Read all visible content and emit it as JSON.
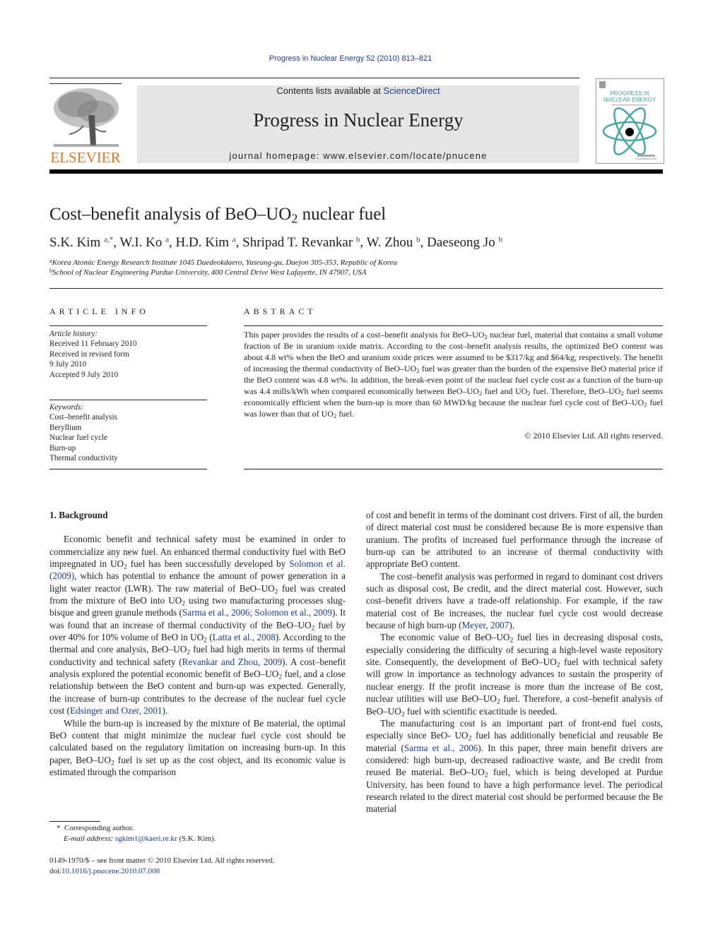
{
  "header": {
    "citation": "Progress in Nuclear Energy 52 (2010) 813–821",
    "contents_prefix": "Contents lists available at ",
    "contents_link": "ScienceDirect",
    "journal_title": "Progress in Nuclear Energy",
    "homepage": "journal homepage: www.elsevier.com/locate/pnucene",
    "publisher_logo_text": "ELSEVIER",
    "cover": {
      "title_line1": "PROGRESS IN",
      "title_line2": "NUCLEAR ENERGY",
      "accent_color": "#4aa6a0",
      "logo_color": "#e87722"
    }
  },
  "article": {
    "title_pre": "Cost–benefit analysis of BeO–UO",
    "title_sub": "2",
    "title_post": " nuclear fuel",
    "authors": [
      {
        "name": "S.K. Kim",
        "sup": "a,*"
      },
      {
        "name": "W.I. Ko",
        "sup": "a"
      },
      {
        "name": "H.D. Kim",
        "sup": "a"
      },
      {
        "name": "Shripad T. Revankar",
        "sup": "b"
      },
      {
        "name": "W. Zhou",
        "sup": "b"
      },
      {
        "name": "Daeseong Jo",
        "sup": "b"
      }
    ],
    "affiliations": [
      {
        "mark": "a",
        "text": "Korea Atomic Energy Research Institute 1045 Daedeokdaero, Yuseung-gu, Daejon 305-353, Republic of Korea"
      },
      {
        "mark": "b",
        "text": "School of Nuclear Engineering Purdue University, 400 Central Drive West Lafayette, IN 47907, USA"
      }
    ]
  },
  "article_info": {
    "heading": "ARTICLE INFO",
    "history_label": "Article history:",
    "history": [
      "Received 11 February 2010",
      "Received in revised form",
      "9 July 2010",
      "Accepted 9 July 2010"
    ],
    "keywords_label": "Keywords:",
    "keywords": [
      "Cost–benefit analysis",
      "Beryllium",
      "Nuclear fuel cycle",
      "Burn-up",
      "Thermal conductivity"
    ]
  },
  "abstract": {
    "heading": "ABSTRACT",
    "segments": [
      "This paper provides the results of a cost–benefit analysis for BeO–UO",
      "2",
      " nuclear fuel, material that contains a small volume fraction of Be in uranium oxide matrix. According to the cost–benefit analysis results, the optimized BeO content was about 4.8 wt% when the BeO and uranium oxide prices were assumed to be $317/kg and $64/kg, respectively. The benefit of increasing the thermal conductivity of BeO–UO",
      "2",
      " fuel was greater than the burden of the expensive BeO material price if the BeO content was 4.8 wt%. In addition, the break-even point of the nuclear fuel cycle cost as a function of the burn-up was 4.4 mills/kWh when compared economically between BeO–UO",
      "2",
      " fuel and UO",
      "2",
      " fuel. Therefore, BeO–UO",
      "2",
      " fuel seems economically efficient when the burn-up is more than 60 MWD/kg because the nuclear fuel cycle cost of BeO–UO",
      "2",
      " fuel was lower than that of UO",
      "2",
      " fuel."
    ],
    "copyright": "© 2010 Elsevier Ltd. All rights reserved."
  },
  "body": {
    "section_heading": "1.  Background",
    "left_paragraphs": [
      [
        {
          "t": "Economic benefit and technical safety must be examined in order to commercialize any new fuel. An enhanced thermal conductivity fuel with BeO impregnated in UO"
        },
        {
          "s": "2"
        },
        {
          "t": " fuel has been successfully developed by "
        },
        {
          "l": "Solomon et al. (2009)"
        },
        {
          "t": ", which has potential to enhance the amount of power generation in a light water reactor (LWR). The raw material of BeO–UO"
        },
        {
          "s": "2"
        },
        {
          "t": " fuel was created from the mixture of BeO into UO"
        },
        {
          "s": "2"
        },
        {
          "t": " using two manufacturing processes slug-bisque and green granule methods ("
        },
        {
          "l": "Sarma et al., 2006; Solomon et al., 2009"
        },
        {
          "t": "). It was found that an increase of thermal conductivity of the BeO–UO"
        },
        {
          "s": "2"
        },
        {
          "t": " fuel by over 40% for 10% volume of BeO in UO"
        },
        {
          "s": "2"
        },
        {
          "t": " ("
        },
        {
          "l": "Latta et al., 2008"
        },
        {
          "t": "). According to the thermal and core analysis, BeO–UO"
        },
        {
          "s": "2"
        },
        {
          "t": " fuel had high merits in terms of thermal conductivity and technical safety ("
        },
        {
          "l": "Revankar and Zhou, 2009"
        },
        {
          "t": "). A cost–benefit analysis explored the potential economic benefit of BeO–UO"
        },
        {
          "s": "2"
        },
        {
          "t": " fuel, and a close relationship between the BeO content and burn-up was expected. Generally, the increase of burn-up contributes to the decrease of the nuclear fuel cycle cost ("
        },
        {
          "l": "Edsinger and Ozer, 2001"
        },
        {
          "t": ")."
        }
      ],
      [
        {
          "t": "While the burn-up is increased by the mixture of Be material, the optimal BeO content that might minimize the nuclear fuel cycle cost should be calculated based on the regulatory limitation on increasing burn-up. In this paper, BeO–UO"
        },
        {
          "s": "2"
        },
        {
          "t": " fuel is set up as the cost object, and its economic value is estimated through the comparison"
        }
      ]
    ],
    "right_paragraphs": [
      [
        {
          "t": "of cost and benefit in terms of the dominant cost drivers. First of all, the burden of direct material cost must be considered because Be is more expensive than uranium. The profits of increased fuel performance through the increase of burn-up can be attributed to an increase of thermal conductivity with appropriate BeO content."
        }
      ],
      [
        {
          "t": "The cost–benefit analysis was performed in regard to dominant cost drivers such as disposal cost, Be credit, and the direct material cost. However, such cost–benefit drivers have a trade-off relationship. For example, if the raw material cost of Be increases, the nuclear fuel cycle cost would decrease because of high burn-up ("
        },
        {
          "l": "Meyer, 2007"
        },
        {
          "t": ")."
        }
      ],
      [
        {
          "t": "The economic value of BeO–UO"
        },
        {
          "s": "2"
        },
        {
          "t": " fuel lies in decreasing disposal costs, especially considering the difficulty of securing a high-level waste repository site. Consequently, the development of BeO–UO"
        },
        {
          "s": "2"
        },
        {
          "t": " fuel with technical safety will grow in importance as technology advances to sustain the prosperity of nuclear energy. If the profit increase is more than the increase of Be cost, nuclear utilities will use BeO–UO"
        },
        {
          "s": "2"
        },
        {
          "t": " fuel. Therefore, a cost–benefit analysis of BeO–UO"
        },
        {
          "s": "2"
        },
        {
          "t": " fuel with scientific exactitude is needed."
        }
      ],
      [
        {
          "t": "The manufacturing cost is an important part of front-end fuel costs, especially since BeO- UO"
        },
        {
          "s": "2"
        },
        {
          "t": " fuel has additionally beneficial and reusable Be material ("
        },
        {
          "l": "Sarma et al., 2006"
        },
        {
          "t": "). In this paper, three main benefit drivers are considered: high burn-up, decreased radioactive waste, and Be credit from reused Be material. BeO–UO"
        },
        {
          "s": "2"
        },
        {
          "t": " fuel, which is being developed at Purdue University, has been found to have a high performance level. The periodical research related to the direct material cost should be performed because the Be material"
        }
      ]
    ]
  },
  "footnote": {
    "marker": "*",
    "corresponding": "Corresponding author.",
    "email_label": "E-mail address:",
    "email": "sgkim1@kaeri.re.kr",
    "email_suffix": " (S.K. Kim)."
  },
  "front_matter": {
    "issn_line": "0149-1970/$ – see front matter © 2010 Elsevier Ltd. All rights reserved.",
    "doi_label": "doi:",
    "doi": "10.1016/j.pnucene.2010.07.008"
  }
}
